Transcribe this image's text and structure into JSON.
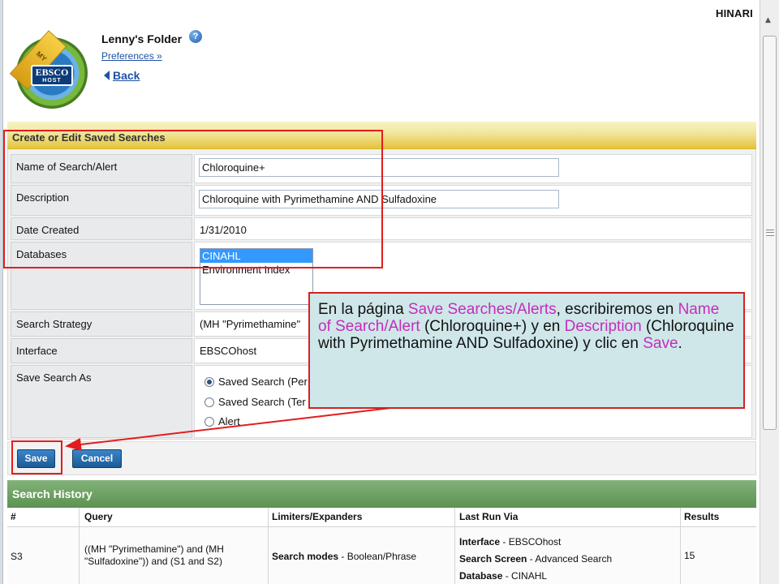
{
  "brand": "HINARI",
  "logo": {
    "ribbon": "MY",
    "word": "EBSCO",
    "sub": "HOST"
  },
  "folder": {
    "title": "Lenny's Folder",
    "help": "?",
    "preferences": "Preferences »",
    "back": "Back"
  },
  "form": {
    "header": "Create or Edit Saved Searches",
    "name_label": "Name of Search/Alert",
    "name_value": "Chloroquine+",
    "description_label": "Description",
    "description_value": "Chloroquine with Pyrimethamine AND Sulfadoxine",
    "date_label": "Date Created",
    "date_value": "1/31/2010",
    "databases_label": "Databases",
    "databases": [
      "CINAHL",
      "Environment Index"
    ],
    "strategy_label": "Search Strategy",
    "strategy_value": "(MH \"Pyrimethamine\"",
    "interface_label": "Interface",
    "interface_value": "EBSCOhost",
    "save_as_label": "Save Search As",
    "save_options": [
      "Saved Search (Per",
      "Saved Search (Ter",
      "Alert"
    ],
    "save_button": "Save",
    "cancel_button": "Cancel"
  },
  "history": {
    "header": "Search History",
    "columns": [
      "#",
      "Query",
      "Limiters/Expanders",
      "Last Run Via",
      "Results"
    ],
    "row": {
      "id": "S3",
      "query_line1": "((MH \"Pyrimethamine\") and (MH",
      "query_line2": "\"Sulfadoxine\")) and (S1 and S2)",
      "limiter_label": "Search modes",
      "limiter_value": " - Boolean/Phrase",
      "run_interface_label": "Interface",
      "run_interface_value": " - EBSCOhost",
      "run_screen_label": "Search Screen",
      "run_screen_value": " - Advanced Search",
      "run_database_label": "Database",
      "run_database_value": " - CINAHL",
      "results": "15"
    }
  },
  "callout": {
    "t1": "En la página ",
    "h1": "Save Searches/Alerts",
    "t2": ", escribiremos en ",
    "h2": "Name of Search/Alert",
    "t3": " (Chloroquine+) y en ",
    "h3": "Description",
    "t4": " (Chloroquine with Pyrimethamine AND Sulfadoxine) y clic en ",
    "h4": "Save",
    "t5": "."
  },
  "colors": {
    "annotation_red": "#e21d1d",
    "highlight_magenta": "#c42dbb",
    "callout_bg": "#cfe7e9",
    "history_green": "#5d9250"
  }
}
